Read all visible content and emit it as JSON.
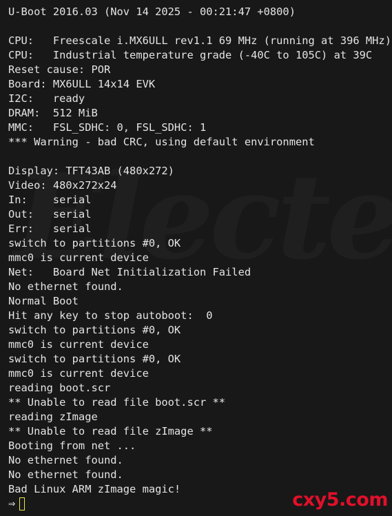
{
  "terminal": {
    "lines": [
      "U-Boot 2016.03 (Nov 14 2025 - 00:21:47 +0800)",
      "",
      "CPU:   Freescale i.MX6ULL rev1.1 69 MHz (running at 396 MHz)",
      "CPU:   Industrial temperature grade (-40C to 105C) at 39C",
      "Reset cause: POR",
      "Board: MX6ULL 14x14 EVK",
      "I2C:   ready",
      "DRAM:  512 MiB",
      "MMC:   FSL_SDHC: 0, FSL_SDHC: 1",
      "*** Warning - bad CRC, using default environment",
      "",
      "Display: TFT43AB (480x272)",
      "Video: 480x272x24",
      "In:    serial",
      "Out:   serial",
      "Err:   serial",
      "switch to partitions #0, OK",
      "mmc0 is current device",
      "Net:   Board Net Initialization Failed",
      "No ethernet found.",
      "Normal Boot",
      "Hit any key to stop autoboot:  0",
      "switch to partitions #0, OK",
      "mmc0 is current device",
      "switch to partitions #0, OK",
      "mmc0 is current device",
      "reading boot.scr",
      "** Unable to read file boot.scr **",
      "reading zImage",
      "** Unable to read file zImage **",
      "Booting from net ...",
      "No ethernet found.",
      "No ethernet found.",
      "Bad Linux ARM zImage magic!"
    ],
    "prompt_symbol": "⇒",
    "cursor_color": "#e8e84a",
    "text_color": "#e4e4e4",
    "background_color": "#181818"
  },
  "watermarks": {
    "background_text": "Electe",
    "site_text": "cxy5.com",
    "site_color": "#e0102a"
  }
}
